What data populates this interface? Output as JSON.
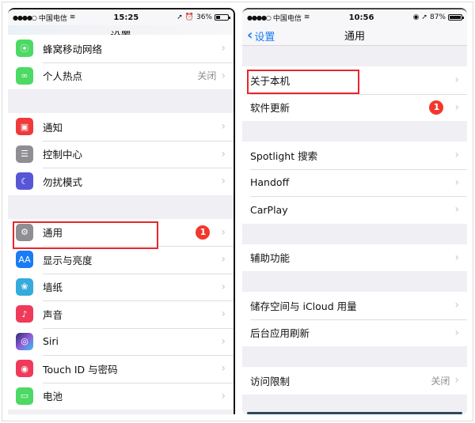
{
  "left_phone": {
    "status": {
      "carrier": "中国电信",
      "signal": "●●●●○",
      "time": "15:25",
      "battery_pct": 36,
      "battery_text": "36%"
    },
    "title": "设置",
    "groups": [
      [
        {
          "label": "蜂窝移动网络",
          "icon": "cellular-icon",
          "color": "#4cd964",
          "value": ""
        },
        {
          "label": "个人热点",
          "icon": "hotspot-icon",
          "color": "#4cd964",
          "value": "关闭"
        }
      ],
      [
        {
          "label": "通知",
          "icon": "notifications-icon",
          "color": "#f0393b",
          "value": ""
        },
        {
          "label": "控制中心",
          "icon": "control-center-icon",
          "color": "#8e8e93",
          "value": ""
        },
        {
          "label": "勿扰模式",
          "icon": "moon-icon",
          "color": "#5856d6",
          "value": ""
        }
      ],
      [
        {
          "label": "通用",
          "icon": "gear-icon",
          "color": "#8e8e93",
          "value": "",
          "badge": "1"
        },
        {
          "label": "显示与亮度",
          "icon": "display-icon",
          "color": "#1a7cf5",
          "value": ""
        },
        {
          "label": "墙纸",
          "icon": "wallpaper-icon",
          "color": "#35aadc",
          "value": ""
        },
        {
          "label": "声音",
          "icon": "sound-icon",
          "color": "#f03a5a",
          "value": ""
        },
        {
          "label": "Siri",
          "icon": "siri-icon",
          "color": "#2a2d6e",
          "value": ""
        },
        {
          "label": "Touch ID 与密码",
          "icon": "fingerprint-icon",
          "color": "#f03a5a",
          "value": ""
        },
        {
          "label": "电池",
          "icon": "battery-icon",
          "color": "#4cd964",
          "value": ""
        }
      ]
    ]
  },
  "right_phone": {
    "status": {
      "carrier": "中国电信",
      "signal": "●●●●○",
      "time": "10:56",
      "battery_pct": 87,
      "battery_text": "87%"
    },
    "back_label": "设置",
    "title": "通用",
    "groups": [
      [
        {
          "label": "关于本机",
          "value": ""
        },
        {
          "label": "软件更新",
          "value": "",
          "badge": "1"
        }
      ],
      [
        {
          "label": "Spotlight 搜索",
          "value": ""
        },
        {
          "label": "Handoff",
          "value": ""
        },
        {
          "label": "CarPlay",
          "value": ""
        }
      ],
      [
        {
          "label": "辅助功能",
          "value": ""
        }
      ],
      [
        {
          "label": "储存空间与 iCloud 用量",
          "value": ""
        },
        {
          "label": "后台应用刷新",
          "value": ""
        }
      ],
      [
        {
          "label": "访问限制",
          "value": "关闭"
        }
      ]
    ]
  },
  "chevron": "›",
  "highlight_color": "#e8262b"
}
